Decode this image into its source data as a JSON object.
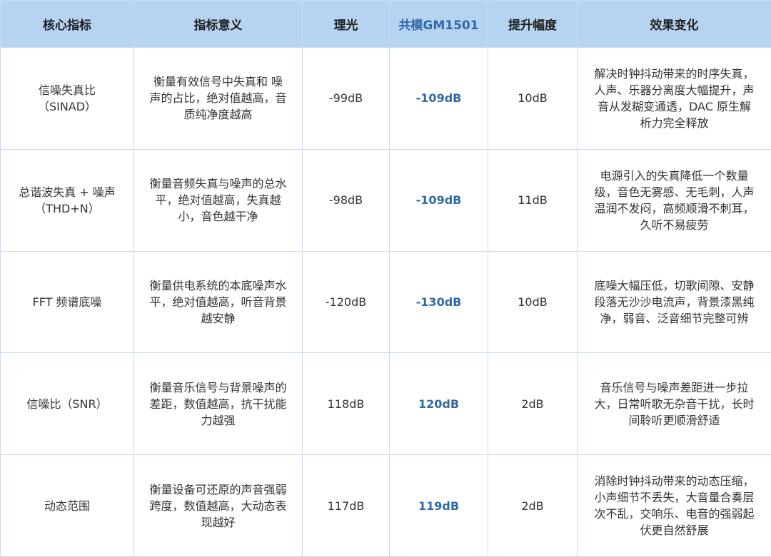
{
  "table": {
    "headers": [
      "核心指标",
      "指标意义",
      "理光",
      "共模GM1501",
      "提升幅度",
      "效果变化"
    ],
    "rows": [
      {
        "metric": [
          "信噪失真比",
          "（SINAD）"
        ],
        "meaning": [
          "衡量有效信号中失真和 噪",
          "声的占比，绝对值越高，音",
          "质纯净度越高"
        ],
        "ricoh": "-99dB",
        "gm1501": "-109dB",
        "improvement": "10dB",
        "effect": [
          "解决时钟抖动带来的时序失真，",
          "人声、乐器分离度大幅提升，声",
          "音从发糊变通透，DAC 原生解",
          "析力完全释放"
        ]
      },
      {
        "metric": [
          "总谐波失真 + 噪声",
          "（THD+N）"
        ],
        "meaning": [
          "衡量音频失真与噪声的总水",
          "平，绝对值越高，失真越",
          "小，音色越干净"
        ],
        "ricoh": "-98dB",
        "gm1501": "-109dB",
        "improvement": "11dB",
        "effect": [
          "电源引入的失真降低一个数量",
          "级，音色无雾感、无毛刺，人声",
          "温润不发闷，高频顺滑不刺耳，",
          "久听不易疲劳"
        ]
      },
      {
        "metric": [
          "FFT 频谱底噪"
        ],
        "meaning": [
          "衡量供电系统的本底噪声水",
          "平，绝对值越高，听音背景",
          "越安静"
        ],
        "ricoh": "-120dB",
        "gm1501": "-130dB",
        "improvement": "10dB",
        "effect": [
          "底噪大幅压低，切歌间隙、安静",
          "段落无沙沙电流声，背景漆黑纯",
          "净，弱音、泛音细节完整可辨"
        ]
      },
      {
        "metric": [
          "信噪比（SNR）"
        ],
        "meaning": [
          "衡量音乐信号与背景噪声的",
          "差距，数值越高，抗干扰能",
          "力越强"
        ],
        "ricoh": "118dB",
        "gm1501": "120dB",
        "improvement": "2dB",
        "effect": [
          "音乐信号与噪声差距进一步拉",
          "大，日常听歌无杂音干扰，长时",
          "间聆听更顺滑舒适"
        ]
      },
      {
        "metric": [
          "动态范围"
        ],
        "meaning": [
          "衡量设备可还原的声音强弱",
          "跨度，数值越高，大动态表",
          "现越好"
        ],
        "ricoh": "117dB",
        "gm1501": "119dB",
        "improvement": "2dB",
        "effect": [
          "消除时钟抖动带来的动态压缩，",
          "小声细节不丢失，大音量合奏层",
          "次不乱，交响乐、电音的强弱起",
          "伏更自然舒展"
        ]
      }
    ]
  },
  "colors": {
    "header_bg": "#b6d3f1",
    "highlight": "#2f6aa8",
    "border": "#c9dbef"
  }
}
